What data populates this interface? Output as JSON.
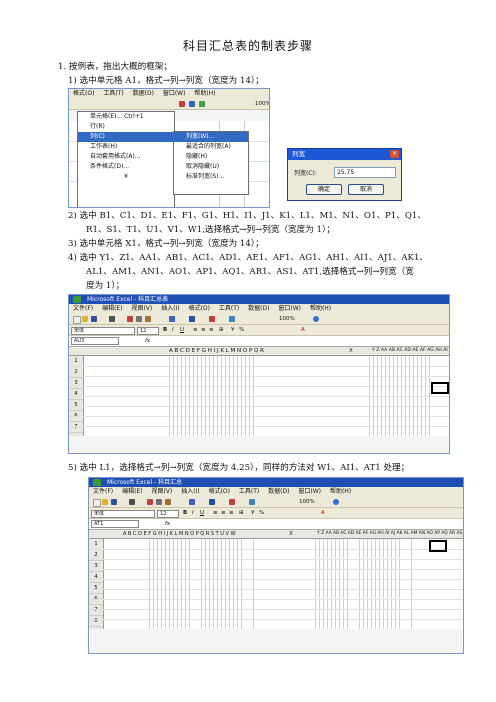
{
  "title": "科目汇总表的制表步骤",
  "steps": {
    "s1": "1.  按例表，拖出大概的框架；",
    "s1_1": "1)   选中单元格 A1，格式→列→列宽（宽度为 14）；",
    "s1_2a": "2)   选中 B1、C1、D1、E1、F1、G1、H1、I1、J1、K1、L1、M1、N1、O1、P1、Q1、",
    "s1_2b": "R1、S1、T1、U1、V1、W1,选择格式→列→列宽（宽度为 1）；",
    "s1_3": "3)   选中单元格 X1，格式→列→列宽（宽度为 14）；",
    "s1_4a": "4)   选中 Y1、Z1、AA1、AB1、AC1、AD1、AE1、AF1、AG1、AH1、AI1、AJ1、AK1、",
    "s1_4b": "AL1、AM1、AN1、AO1、AP1、AQ1、AR1、AS1、AT1,选择格式→列→列宽（宽",
    "s1_4c": "度为 1）；",
    "s1_5": "5)   选中 L1，选择格式→列→列宽（宽度为 4.25），同样的方法对 W1、AI1、AT1 处理；"
  },
  "shot1": {
    "menubar": [
      "格式(O)",
      "工具(T)",
      "数据(D)",
      "窗口(W)",
      "帮助(H)"
    ],
    "format_menu": [
      "单元格(E)...  Ctrl+1",
      "行(R)",
      "列(C)",
      "工作表(H)",
      "自动套用格式(A)...",
      "条件格式(D)..."
    ],
    "col_submenu": [
      "列宽(W)...",
      "最适合的列宽(A)",
      "隐藏(H)",
      "取消隐藏(U)",
      "标准列宽(S)..."
    ],
    "zoom": "100%"
  },
  "dialog": {
    "title": "列宽",
    "label": "列宽(C):",
    "value": "25.75",
    "ok": "确定",
    "cancel": "取消"
  },
  "shot2": {
    "window_title": "Microsoft Excel - 科目汇总表",
    "menubar": [
      "文件(F)",
      "编辑(E)",
      "视图(V)",
      "插入(I)",
      "格式(O)",
      "工具(T)",
      "数据(D)",
      "窗口(W)",
      "帮助(H)"
    ],
    "font": "宋体",
    "size": "12",
    "zoom": "100%",
    "namebox": "AU3",
    "fx": "fx",
    "col_headers": "A         B C D E F G H I J K L M N O P Q R",
    "col_x": "X",
    "col_right": "Y Z AA AB AC AD AE AF AG AH AI AJ AK AL AM AN AO AP AQ AR AS AT",
    "rows": [
      "1",
      "2",
      "3",
      "4",
      "5",
      "6",
      "7"
    ]
  },
  "shot3": {
    "window_title": "Microsoft Excel - 科目汇总",
    "menubar": [
      "文件(F)",
      "编辑(E)",
      "视图(V)",
      "插入(I)",
      "格式(O)",
      "工具(T)",
      "数据(D)",
      "窗口(W)",
      "帮助(H)"
    ],
    "font": "宋体",
    "size": "12",
    "zoom": "100%",
    "namebox": "AT1",
    "fx": "fx",
    "col_headers": "A         B C D E F G H I J K  L  M N O P Q R S T U V  W",
    "col_x": "X",
    "col_right": "Y Z AA AB AC AD AE AF AG AH  AI  AJ AK AL AM AN AO AP AQ AR AS  AT",
    "rows": [
      "1",
      "2",
      "3",
      "4",
      "5",
      "6",
      "7",
      "8"
    ]
  }
}
